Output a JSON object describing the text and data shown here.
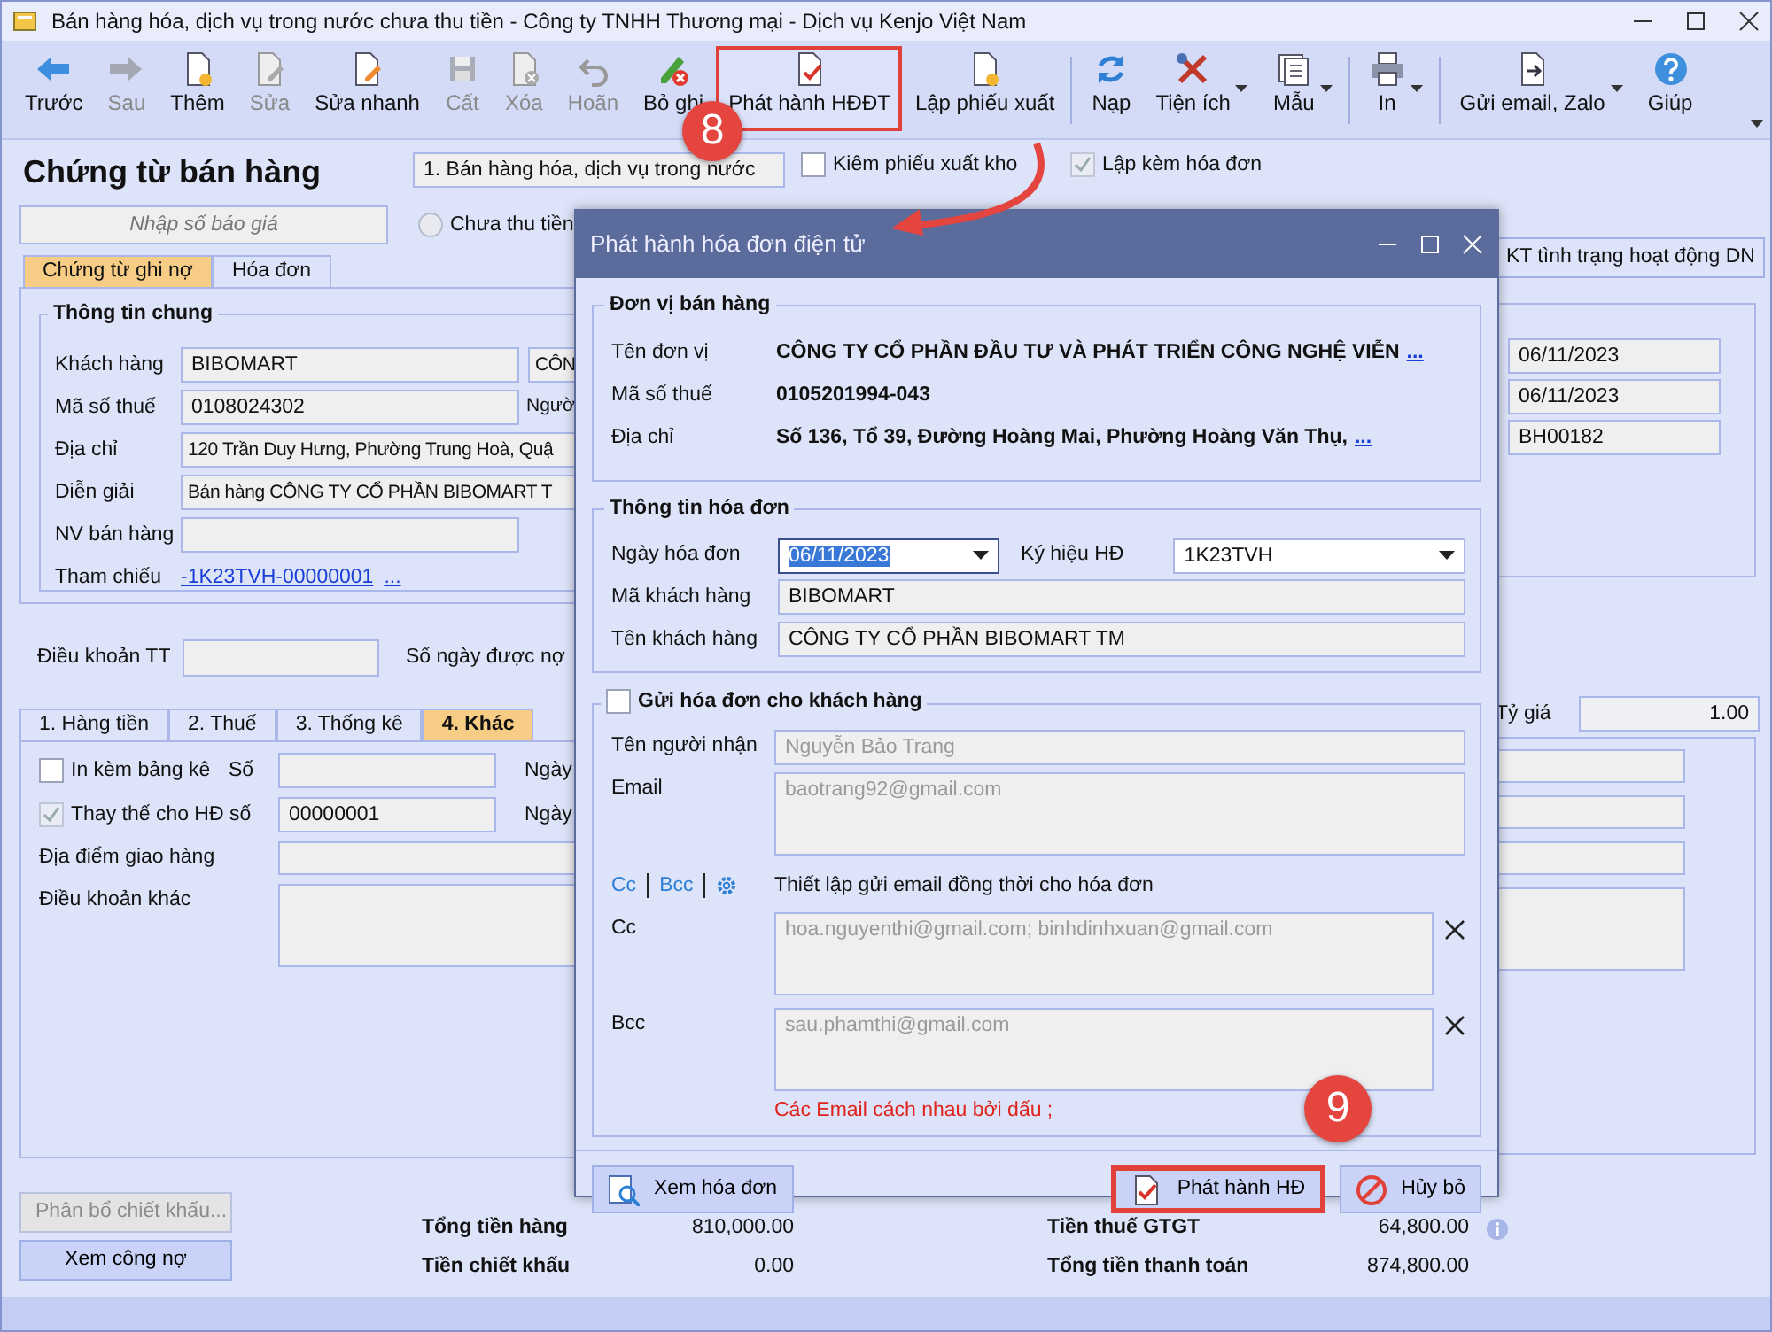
{
  "window": {
    "title": "Bán hàng hóa, dịch vụ trong nước chưa thu tiền - Công ty TNHH Thương mại - Dịch vụ Kenjo Việt Nam"
  },
  "toolbar": [
    {
      "label": "Trước",
      "disabled": false,
      "highlighted": false,
      "dropdown": false,
      "separator_before": false
    },
    {
      "label": "Sau",
      "disabled": true,
      "highlighted": false,
      "dropdown": false,
      "separator_before": false
    },
    {
      "label": "Thêm",
      "disabled": false,
      "highlighted": false,
      "dropdown": false,
      "separator_before": false
    },
    {
      "label": "Sửa",
      "disabled": true,
      "highlighted": false,
      "dropdown": false,
      "separator_before": false
    },
    {
      "label": "Sửa nhanh",
      "disabled": false,
      "highlighted": false,
      "dropdown": false,
      "separator_before": false
    },
    {
      "label": "Cất",
      "disabled": true,
      "highlighted": false,
      "dropdown": false,
      "separator_before": false
    },
    {
      "label": "Xóa",
      "disabled": true,
      "highlighted": false,
      "dropdown": false,
      "separator_before": false
    },
    {
      "label": "Hoãn",
      "disabled": true,
      "highlighted": false,
      "dropdown": false,
      "separator_before": false
    },
    {
      "label": "Bỏ ghi",
      "disabled": false,
      "highlighted": false,
      "dropdown": false,
      "separator_before": false
    },
    {
      "label": "Phát hành HĐĐT",
      "disabled": false,
      "highlighted": true,
      "dropdown": false,
      "separator_before": false
    },
    {
      "label": "Lập phiếu xuất",
      "disabled": false,
      "highlighted": false,
      "dropdown": false,
      "separator_before": false
    },
    {
      "label": "Nạp",
      "disabled": false,
      "highlighted": false,
      "dropdown": false,
      "separator_before": true
    },
    {
      "label": "Tiện ích",
      "disabled": false,
      "highlighted": false,
      "dropdown": true,
      "separator_before": false
    },
    {
      "label": "Mẫu",
      "disabled": false,
      "highlighted": false,
      "dropdown": true,
      "separator_before": false
    },
    {
      "label": "In",
      "disabled": false,
      "highlighted": false,
      "dropdown": true,
      "separator_before": true
    },
    {
      "label": "Gửi email, Zalo",
      "disabled": false,
      "highlighted": false,
      "dropdown": true,
      "separator_before": true
    },
    {
      "label": "Giúp",
      "disabled": false,
      "highlighted": false,
      "dropdown": false,
      "separator_before": false
    }
  ],
  "voucher": {
    "title": "Chứng từ bán hàng",
    "sale_type": "1. Bán hàng hóa, dịch vụ trong nước",
    "options": [
      {
        "label": "Kiêm phiếu xuất kho",
        "checked": false,
        "disabled": false
      },
      {
        "label": "Lập kèm hóa đơn",
        "checked": true,
        "disabled": true
      }
    ],
    "quote_field": {
      "placeholder": "Nhập số báo giá"
    },
    "payment": {
      "label": "Chưa thu tiền",
      "selected": false
    }
  },
  "tabs": [
    {
      "label": "Chứng từ ghi nợ",
      "selected": true
    },
    {
      "label": "Hóa đơn",
      "selected": false
    }
  ],
  "check_business_button": "KT tình trạng hoạt động DN",
  "general": {
    "legend": "Thông tin chung",
    "rows": [
      {
        "kind": "field",
        "label": "Khách hàng",
        "value": "BIBOMART",
        "side_value": "CÔN"
      },
      {
        "kind": "field",
        "label": "Mã số thuế",
        "value": "0108024302",
        "side_label": "Ngườ"
      },
      {
        "kind": "wide",
        "label": "Địa chỉ",
        "value": "120 Trần Duy Hưng, Phường Trung Hoà, Quậ"
      },
      {
        "kind": "wide",
        "label": "Diễn giải",
        "value": "Bán hàng CÔNG TY CỔ PHẦN BIBOMART T"
      },
      {
        "kind": "field",
        "label": "NV bán hàng"
      },
      {
        "kind": "link",
        "label": "Tham chiếu",
        "value": "-1K23TVH-00000001",
        "more": "..."
      }
    ]
  },
  "voucher_info": [
    "06/11/2023",
    "06/11/2023",
    "BH00182"
  ],
  "payment_terms": {
    "label": "Điều khoản TT",
    "days_label": "Số ngày được nợ"
  },
  "detail_tabs": [
    {
      "label": "1. Hàng tiền",
      "selected": false
    },
    {
      "label": "2. Thuế",
      "selected": false
    },
    {
      "label": "3. Thống kê",
      "selected": false
    },
    {
      "label": "4. Khác",
      "selected": true
    }
  ],
  "exchange_rate": {
    "label": "Tỷ giá",
    "value": "1.00"
  },
  "other_rows": [
    {
      "kind": "check",
      "label": "In kèm bảng kê",
      "checked": false,
      "disabled": false,
      "number_label": "Số",
      "date_label": "Ngày"
    },
    {
      "kind": "check",
      "label": "Thay thế cho HĐ số",
      "checked": true,
      "disabled": true,
      "value": "00000001",
      "date_label": "Ngày"
    },
    {
      "kind": "field",
      "label": "Địa điểm giao hàng"
    },
    {
      "kind": "area",
      "label": "Điều khoản khác"
    }
  ],
  "side_buttons": [
    {
      "label": "Phân bổ chiết khấu...",
      "disabled": true
    },
    {
      "label": "Xem công nợ",
      "disabled": false
    }
  ],
  "totals": [
    {
      "label": "Tổng tiền hàng",
      "value": "810,000.00"
    },
    {
      "label": "Tiền chiết khấu",
      "value": "0.00"
    },
    {
      "label": "Tiền thuế GTGT",
      "value": "64,800.00"
    },
    {
      "label": "Tổng tiền thanh toán",
      "value": "874,800.00"
    }
  ],
  "dialog": {
    "title": "Phát hành hóa đơn điện tử",
    "seller": {
      "legend": "Đơn vị bán hàng",
      "rows": [
        {
          "label": "Tên đơn vị",
          "value": "CÔNG TY CỔ PHẦN ĐẦU TƯ VÀ PHÁT TRIỂN CÔNG NGHỆ VIỄN",
          "more": "..."
        },
        {
          "label": "Mã số thuế",
          "value": "0105201994-043"
        },
        {
          "label": "Địa chỉ",
          "value": "Số 136, Tổ 39, Đường Hoàng Mai, Phường Hoàng Văn Thụ,",
          "more": "..."
        }
      ]
    },
    "invoice": {
      "legend": "Thông tin hóa đơn",
      "date": {
        "label": "Ngày hóa đơn",
        "value": "06/11/2023"
      },
      "series": {
        "label": "Ký hiệu HĐ",
        "value": "1K23TVH"
      },
      "rows": [
        {
          "label": "Mã khách hàng",
          "value": "BIBOMART"
        },
        {
          "label": "Tên khách hàng",
          "value": "CÔNG TY CỔ PHẦN BIBOMART TM"
        }
      ]
    },
    "send": {
      "label": "Gửi hóa đơn cho khách hàng",
      "checked": false,
      "recipient": {
        "label": "Tên người nhận",
        "value": "Nguyễn Bảo Trang"
      },
      "email": {
        "label": "Email",
        "value": "baotrang92@gmail.com"
      },
      "links": [
        "Cc",
        "Bcc"
      ],
      "note": "Thiết lập gửi email đồng thời cho hóa đơn",
      "cc": {
        "label": "Cc",
        "value": "hoa.nguyenthi@gmail.com; binhdinhxuan@gmail.com"
      },
      "bcc": {
        "label": "Bcc",
        "value": "sau.phamthi@gmail.com"
      },
      "hint": "Các Email cách nhau bởi dấu ;"
    },
    "buttons": [
      {
        "label": "Xem hóa đơn",
        "highlighted": false
      },
      {
        "label": "Phát hành HĐ",
        "highlighted": true
      },
      {
        "label": "Hủy bỏ",
        "highlighted": false
      }
    ]
  },
  "callouts": [
    {
      "label": "8"
    },
    {
      "label": "9"
    }
  ]
}
